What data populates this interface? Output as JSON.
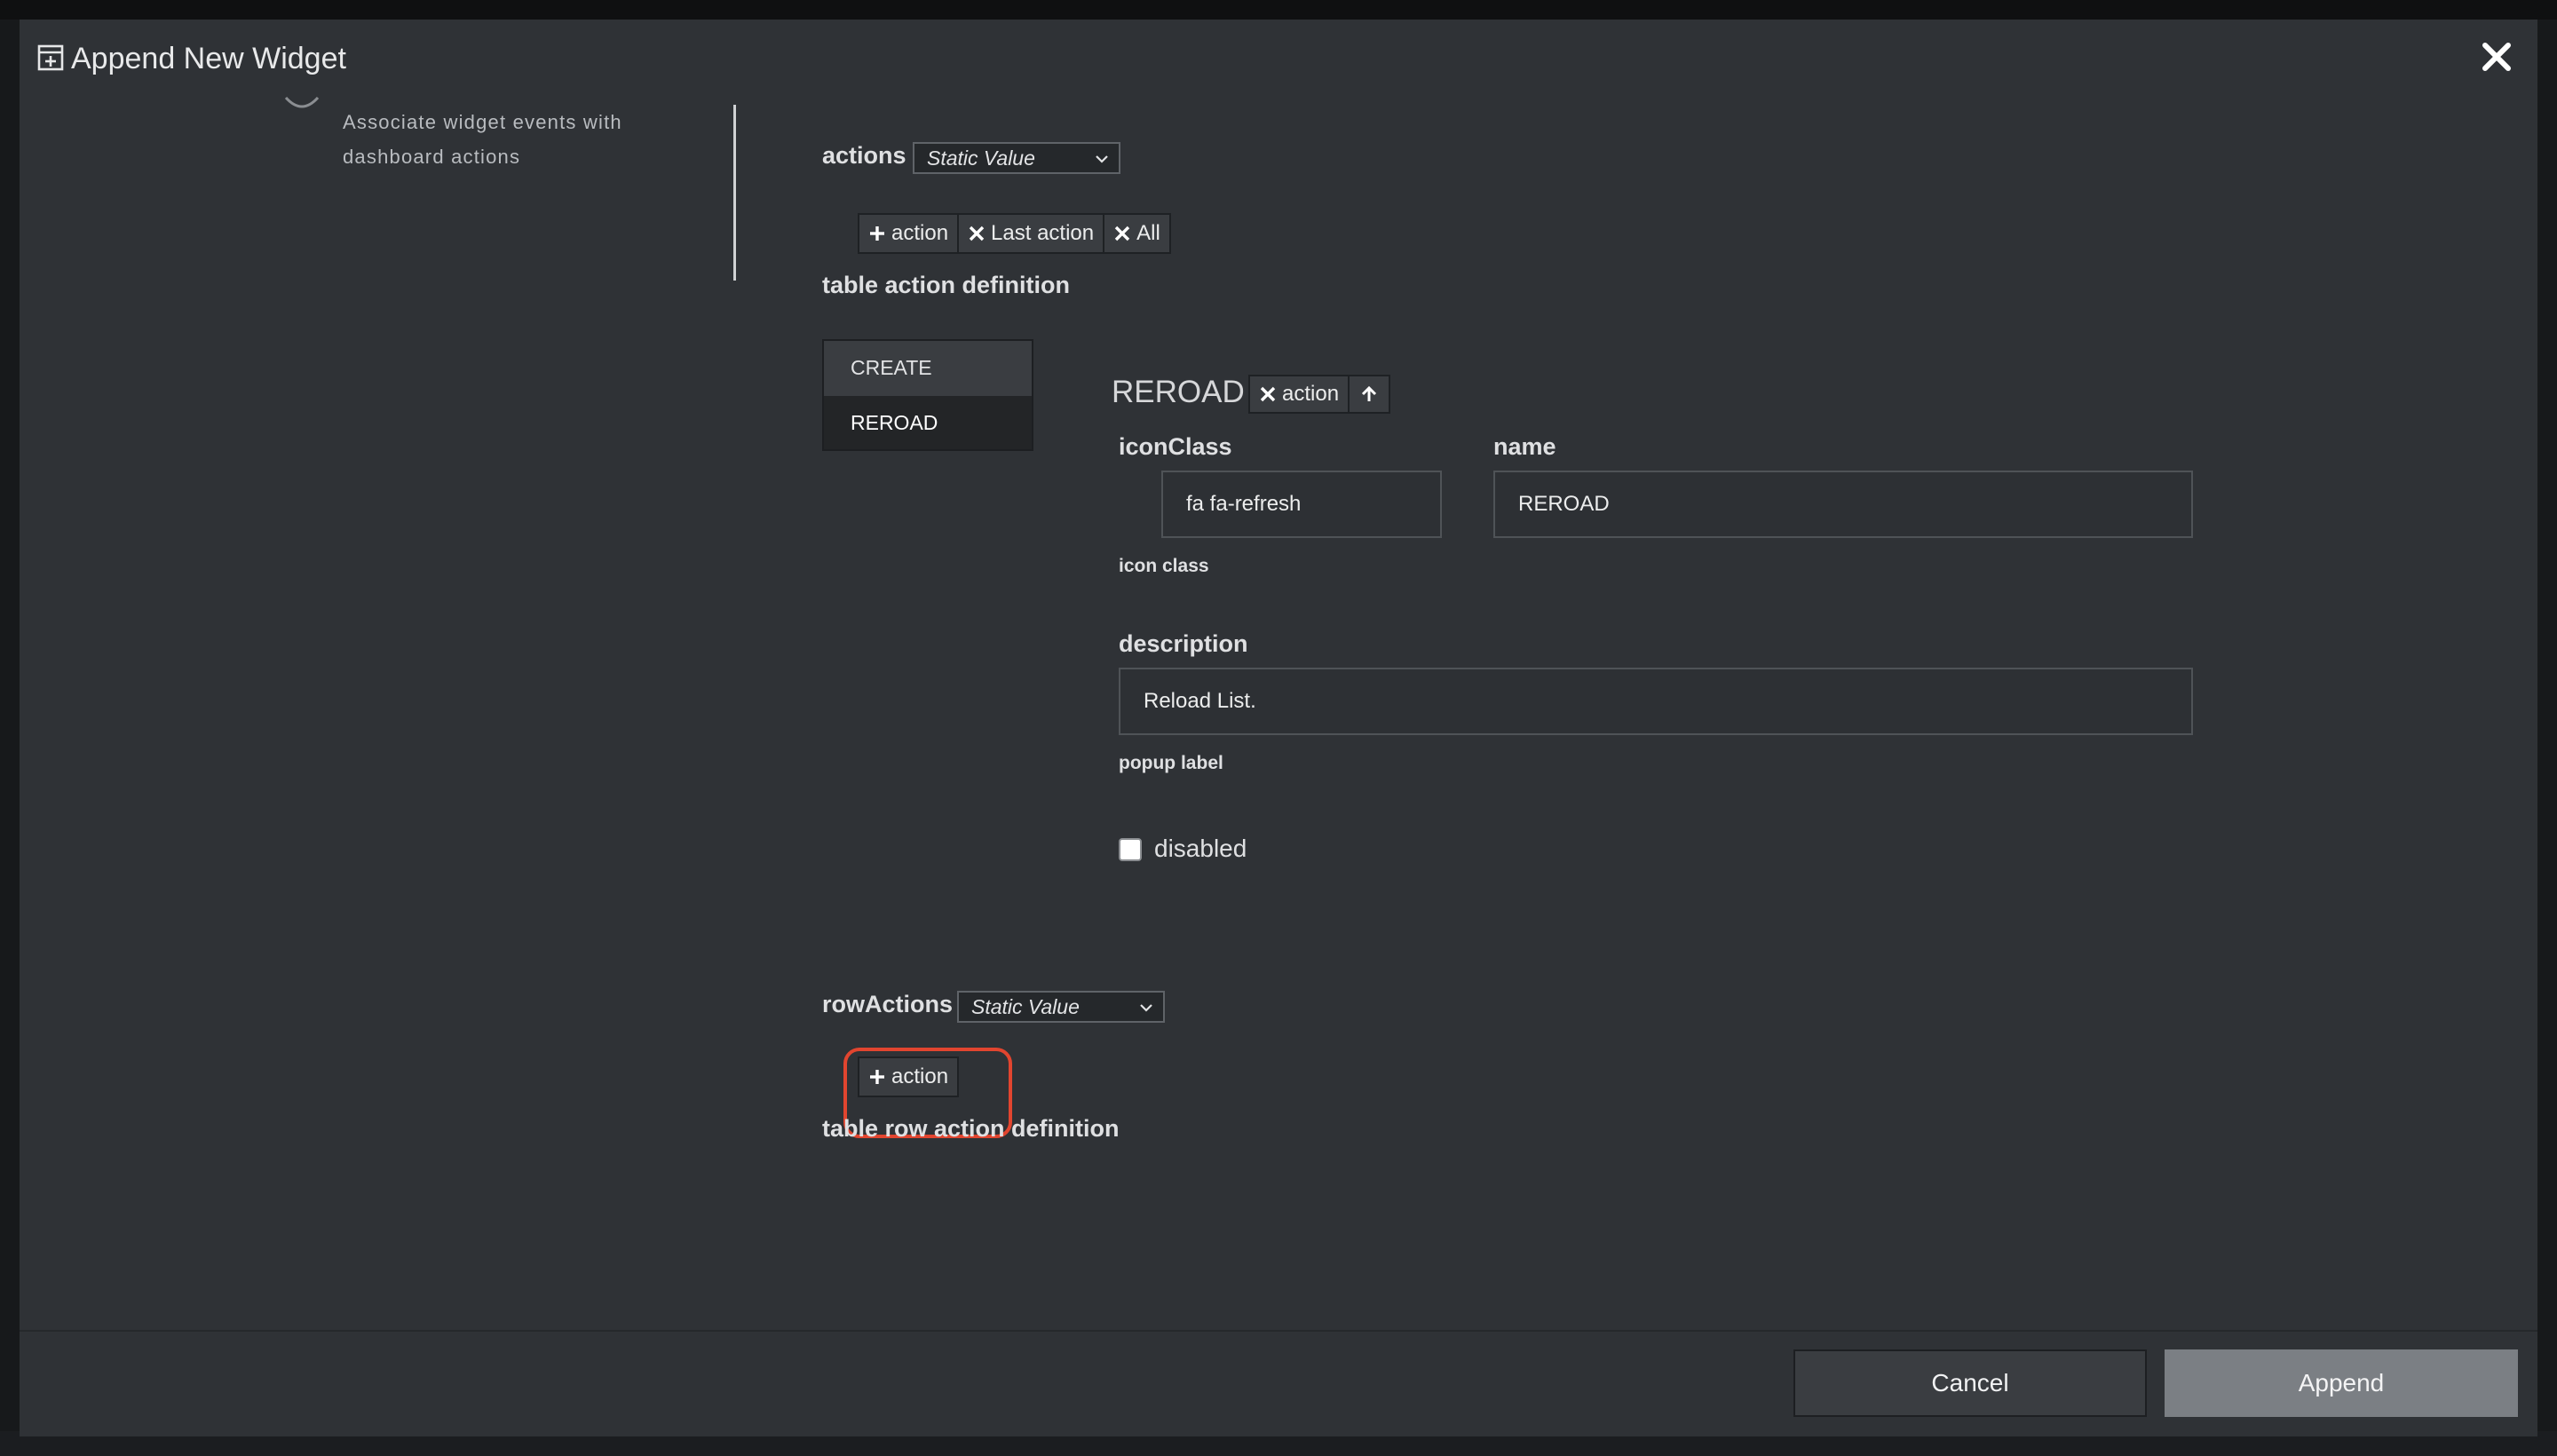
{
  "dialog": {
    "title": "Append New Widget",
    "close_icon": "close-icon",
    "title_icon": "widget-add-icon"
  },
  "stepper": {
    "current_step_description": "Associate widget events with dashboard actions"
  },
  "actions_field": {
    "label": "actions",
    "mode": "Static Value",
    "buttons": {
      "add": "action",
      "remove_last": "Last action",
      "remove_all": "All"
    },
    "hint": "table action definition",
    "list": [
      {
        "label": "CREATE",
        "selected": false
      },
      {
        "label": "REROAD",
        "selected": true
      }
    ]
  },
  "selected_action": {
    "title": "REROAD",
    "remove_button": "action",
    "move_up_icon": "arrow-up-icon",
    "iconClass": {
      "label": "iconClass",
      "value": "fa fa-refresh",
      "hint": "icon class"
    },
    "name": {
      "label": "name",
      "value": "REROAD"
    },
    "description": {
      "label": "description",
      "value": "Reload List.",
      "hint": "popup label"
    },
    "disabled": {
      "label": "disabled",
      "checked": false
    }
  },
  "row_actions_field": {
    "label": "rowActions",
    "mode": "Static Value",
    "add_button": "action",
    "hint": "table row action definition"
  },
  "footer": {
    "cancel": "Cancel",
    "append": "Append"
  },
  "colors": {
    "modal_bg": "#2f3236",
    "button_bg": "#3a3d41",
    "append_bg": "#7b7f84",
    "highlight": "#e2452f"
  }
}
